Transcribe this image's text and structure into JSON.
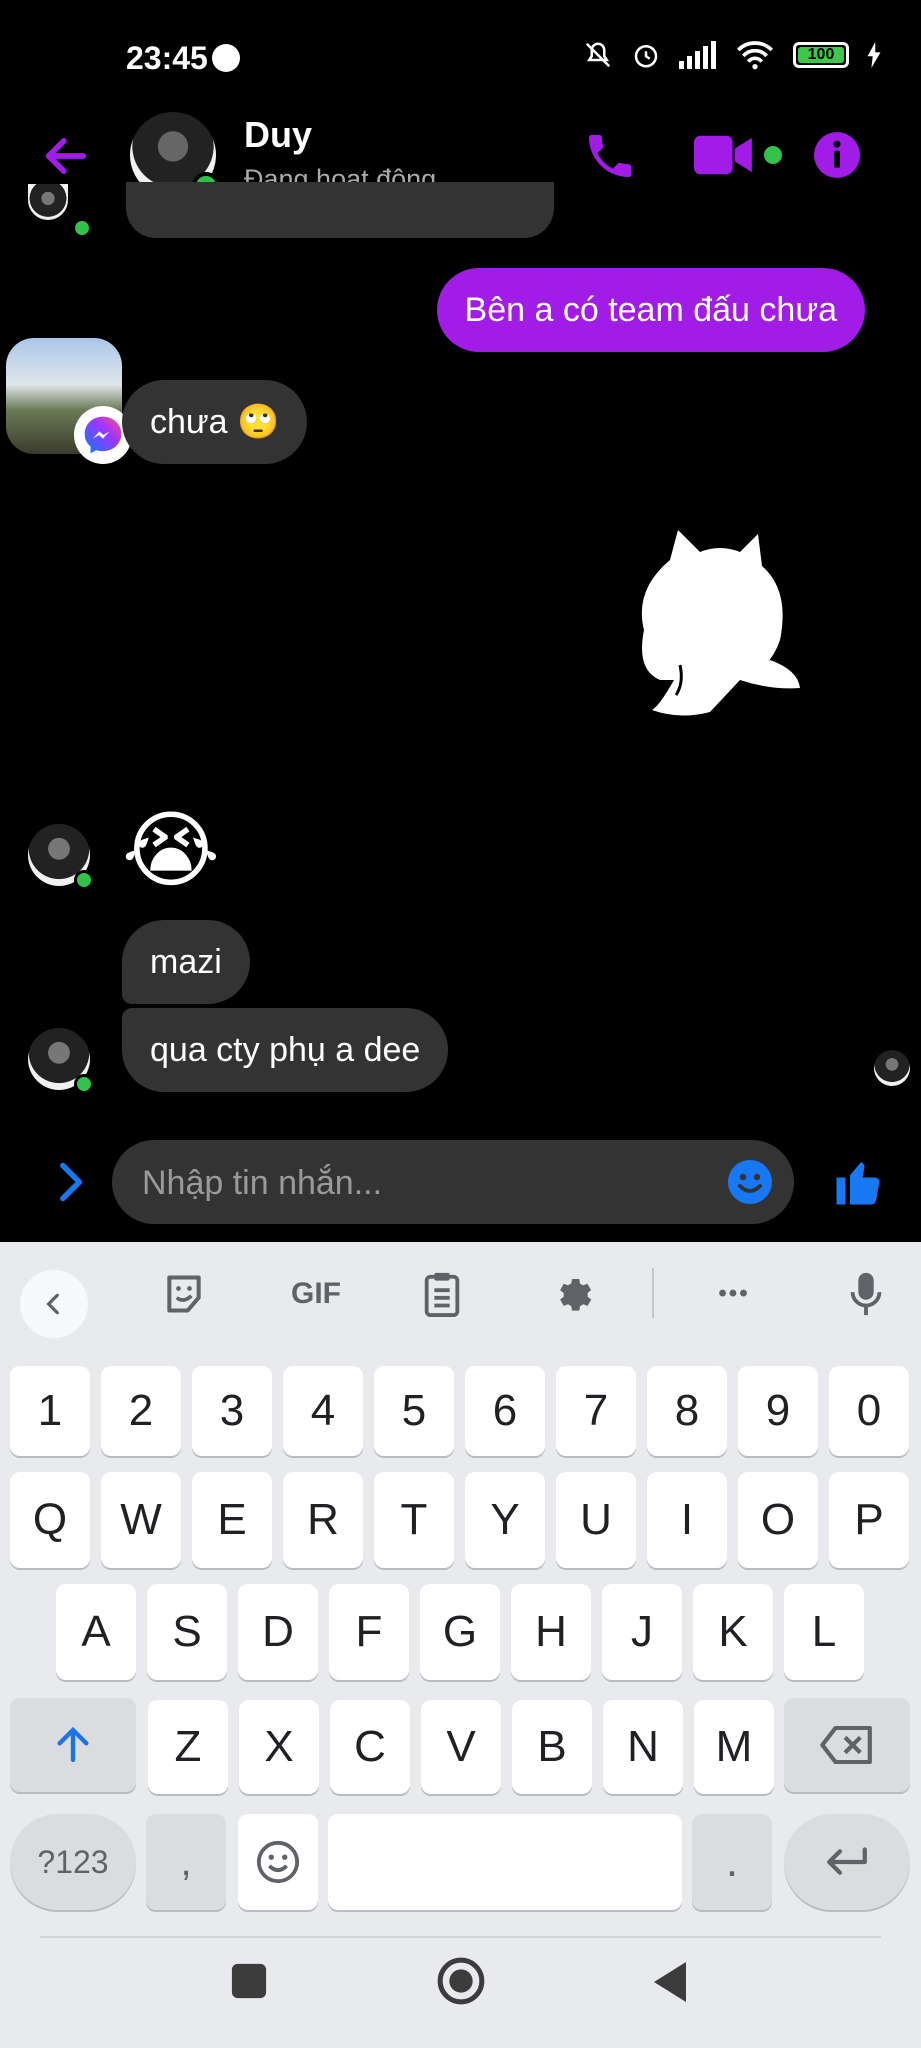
{
  "status_bar": {
    "time": "23:45",
    "battery": "100"
  },
  "header": {
    "name": "Duy",
    "status": "Đang hoạt động"
  },
  "messages": {
    "out_1": "Bên a có team đấu chưa",
    "in_1": "chưa 🙄",
    "in_emoji": "😭",
    "in_2": "mazi",
    "in_3": "qua cty phụ a dee"
  },
  "composer": {
    "placeholder": "Nhập tin nhắn..."
  },
  "keyboard": {
    "toolbar_gif": "GIF",
    "toolbar_more": "•••",
    "row_numbers": [
      "1",
      "2",
      "3",
      "4",
      "5",
      "6",
      "7",
      "8",
      "9",
      "0"
    ],
    "row_1": [
      "Q",
      "W",
      "E",
      "R",
      "T",
      "Y",
      "U",
      "I",
      "O",
      "P"
    ],
    "row_2": [
      "A",
      "S",
      "D",
      "F",
      "G",
      "H",
      "J",
      "K",
      "L"
    ],
    "row_3": [
      "Z",
      "X",
      "C",
      "V",
      "B",
      "N",
      "M"
    ],
    "symbols_key": "?123",
    "comma_key": ",",
    "period_key": "."
  },
  "colors": {
    "accent": "#a11ce6",
    "online": "#31c24a",
    "like_blue": "#1877f2"
  },
  "icons": [
    "back-arrow-icon",
    "phone-icon",
    "video-icon",
    "info-icon",
    "chevron-right-icon",
    "emoji-icon",
    "thumbs-up-icon",
    "sticker-icon",
    "clipboard-icon",
    "gear-icon",
    "microphone-icon",
    "shift-icon",
    "backspace-icon",
    "enter-icon"
  ]
}
